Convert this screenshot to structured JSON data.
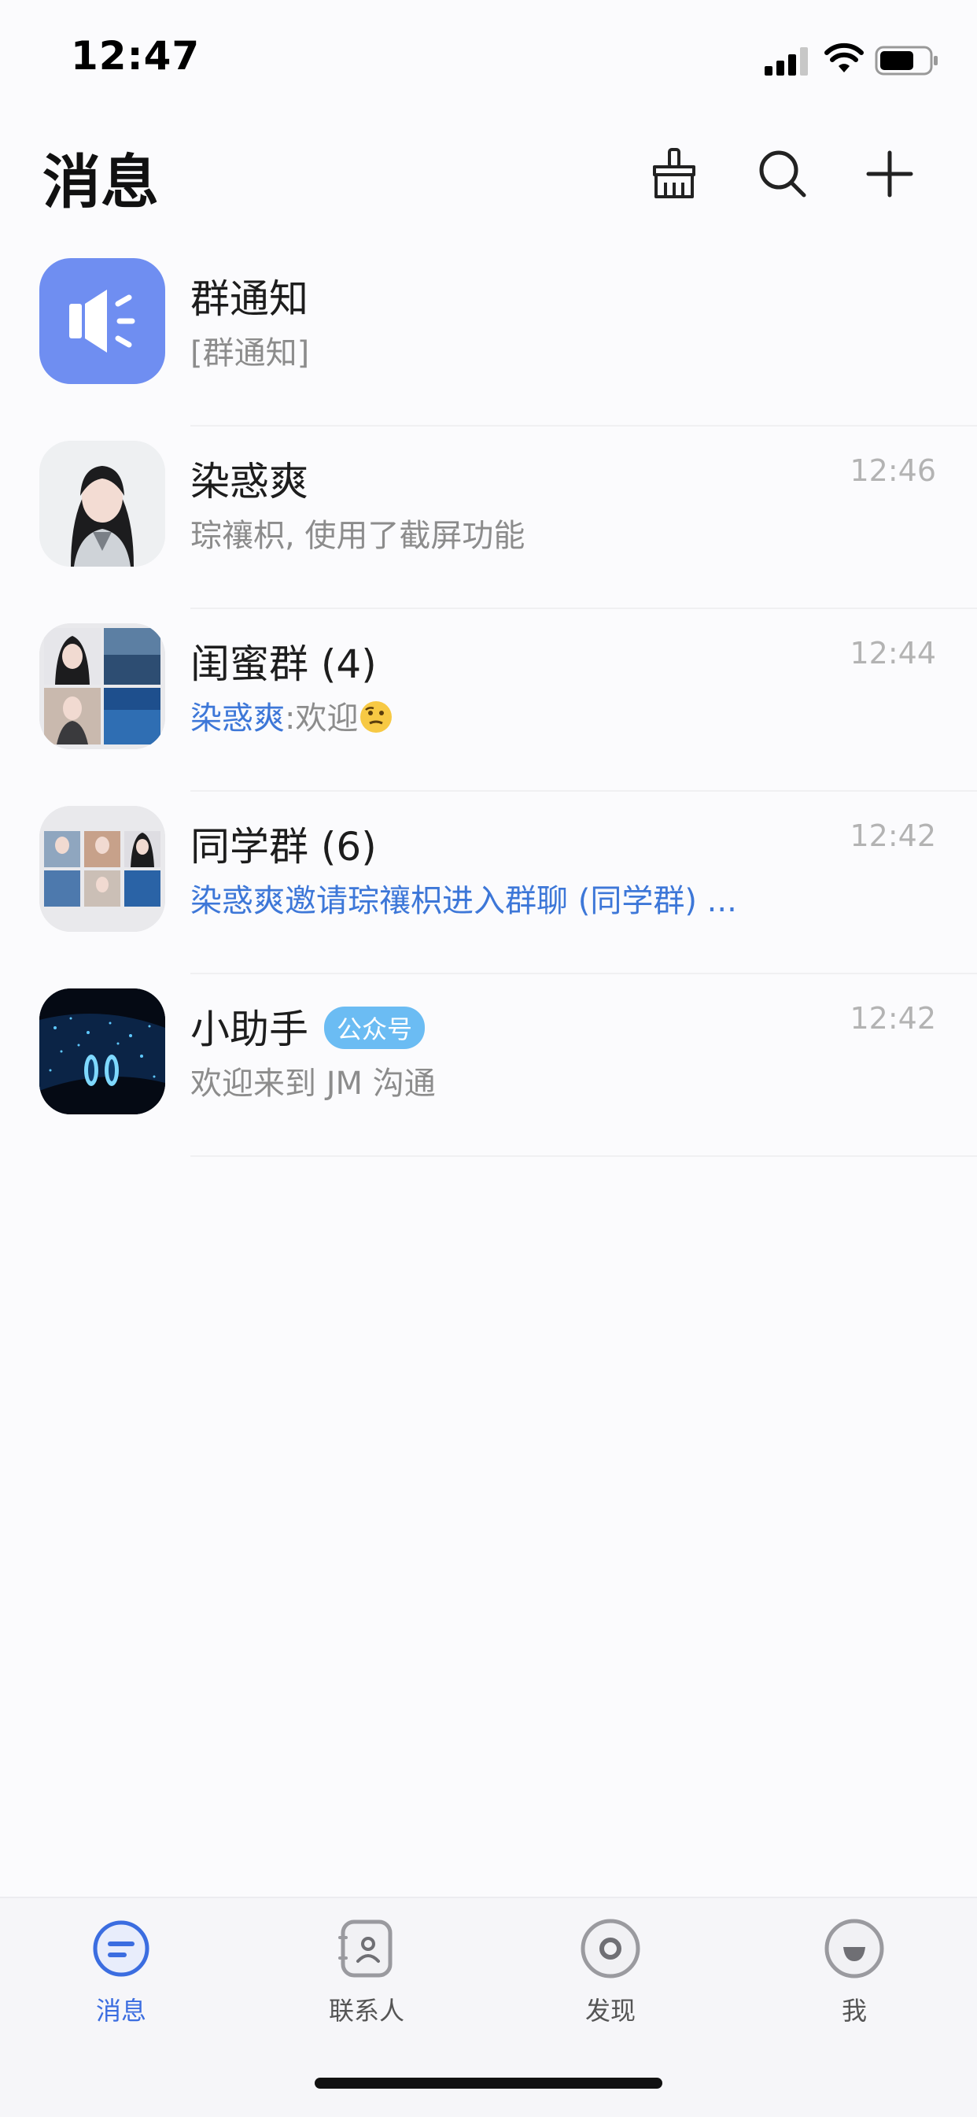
{
  "status_bar": {
    "time": "12:47"
  },
  "header": {
    "title": "消息",
    "icons": [
      "broom-icon",
      "search-icon",
      "plus-icon"
    ]
  },
  "chats": [
    {
      "title": "群通知",
      "preview": "[群通知]",
      "time": ""
    },
    {
      "title": "染惑爽",
      "preview": "琮禳枳, 使用了截屏功能",
      "time": "12:46"
    },
    {
      "title": "闺蜜群 (4)",
      "sender": "染惑爽",
      "preview": ":欢迎",
      "time": "12:44"
    },
    {
      "title": "同学群 (6)",
      "preview": "染惑爽邀请琮禳枳进入群聊 (同学群) ...",
      "time": "12:42"
    },
    {
      "title": "小助手",
      "badge": "公众号",
      "preview": "欢迎来到 JM 沟通",
      "time": "12:42"
    }
  ],
  "tabbar": {
    "tabs": [
      {
        "label": "消息",
        "icon": "message-icon",
        "active": true
      },
      {
        "label": "联系人",
        "icon": "contacts-icon",
        "active": false
      },
      {
        "label": "发现",
        "icon": "discover-icon",
        "active": false
      },
      {
        "label": "我",
        "icon": "profile-icon",
        "active": false
      }
    ]
  },
  "colors": {
    "accent": "#3b6de0",
    "link_blue": "#3d77d8",
    "notice_avatar": "#6f8ef1",
    "badge": "#6bbcf3"
  }
}
